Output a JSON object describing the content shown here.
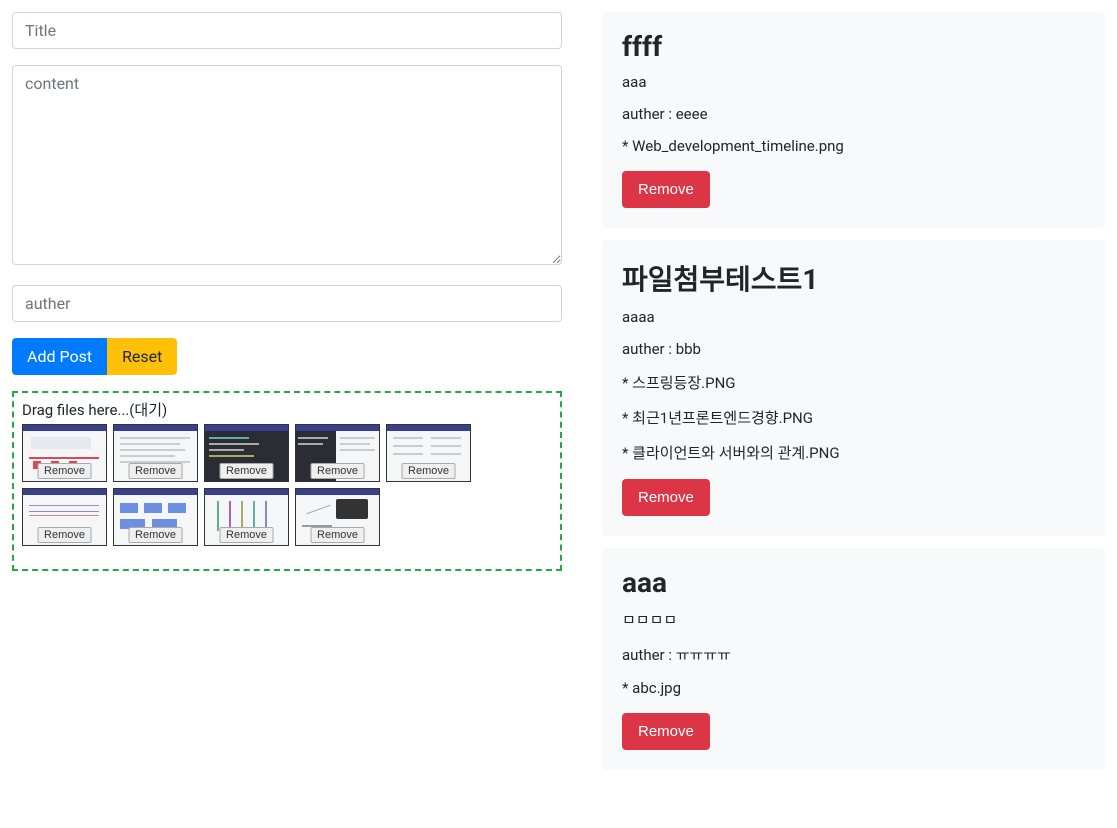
{
  "form": {
    "title_placeholder": "Title",
    "title_value": "",
    "content_placeholder": "content",
    "content_value": "",
    "author_placeholder": "auther",
    "author_value": "",
    "add_button_label": "Add Post",
    "reset_button_label": "Reset"
  },
  "dropzone": {
    "label": "Drag files here...(대기)",
    "thumb_remove_label": "Remove",
    "thumbs": [
      {
        "id": "thumb-0"
      },
      {
        "id": "thumb-1"
      },
      {
        "id": "thumb-2"
      },
      {
        "id": "thumb-3"
      },
      {
        "id": "thumb-4"
      },
      {
        "id": "thumb-5"
      },
      {
        "id": "thumb-6"
      },
      {
        "id": "thumb-7"
      },
      {
        "id": "thumb-8"
      }
    ]
  },
  "posts": [
    {
      "title": "ffff",
      "content": "aaa",
      "author_label": "auther : ",
      "author": "eeee",
      "file_prefix": "* ",
      "files": [
        "Web_development_timeline.png"
      ],
      "remove_label": "Remove"
    },
    {
      "title": "파일첨부테스트1",
      "content": "aaaa",
      "author_label": "auther : ",
      "author": "bbb",
      "file_prefix": "* ",
      "files": [
        "스프링등장.PNG",
        "최근1년프론트엔드경향.PNG",
        "클라이언트와 서버와의 관계.PNG"
      ],
      "remove_label": "Remove"
    },
    {
      "title": "aaa",
      "content": "ㅁㅁㅁㅁ",
      "author_label": "auther : ",
      "author": "ㅠㅠㅠㅠ",
      "file_prefix": "* ",
      "files": [
        "abc.jpg"
      ],
      "remove_label": "Remove"
    }
  ]
}
